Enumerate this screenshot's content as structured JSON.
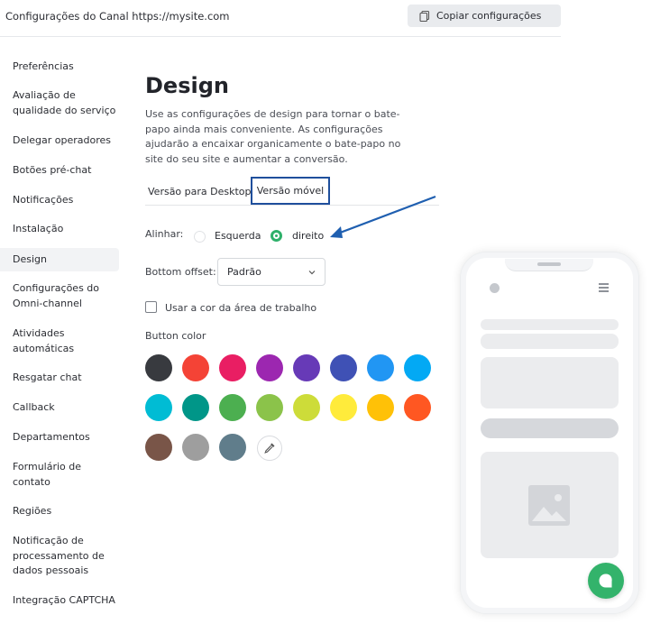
{
  "header": {
    "title": "Configurações do Canal https://mysite.com",
    "copy_button": {
      "label": "Copiar configurações",
      "icon": "copy-icon"
    }
  },
  "sidebar": {
    "items": [
      {
        "label": "Preferências"
      },
      {
        "label": "Avaliação de qualidade do serviço"
      },
      {
        "label": "Delegar operadores"
      },
      {
        "label": "Botões pré-chat"
      },
      {
        "label": "Notificações"
      },
      {
        "label": "Instalação"
      },
      {
        "label": "Design",
        "active": true
      },
      {
        "label": "Configurações do Omni-channel"
      },
      {
        "label": "Atividades automáticas"
      },
      {
        "label": "Resgatar chat"
      },
      {
        "label": "Callback"
      },
      {
        "label": "Departamentos"
      },
      {
        "label": "Formulário de contato"
      },
      {
        "label": "Regiões"
      },
      {
        "label": "Notificação de processamento de dados pessoais"
      },
      {
        "label": "Integração CAPTCHA"
      }
    ]
  },
  "main": {
    "title": "Design",
    "description": "Use as configurações de design para tornar o bate-papo ainda mais conveniente. As configurações ajudarão a encaixar organicamente o bate-papo no site do seu site e aumentar a conversão.",
    "tabs": [
      {
        "label": "Versão para Desktop",
        "selected": false
      },
      {
        "label": "Versão móvel",
        "selected": true
      }
    ],
    "align": {
      "label": "Alinhar:",
      "options": [
        {
          "label": "Esquerda",
          "selected": false
        },
        {
          "label": "direito",
          "selected": true
        }
      ]
    },
    "bottom_offset": {
      "label": "Bottom offset:",
      "value": "Padrão"
    },
    "workspace_color": {
      "label": "Usar a cor da área de trabalho",
      "checked": false
    },
    "button_color": {
      "label": "Button color",
      "colors": [
        "#383a3f",
        "#f44336",
        "#e91e63",
        "#9c27b0",
        "#673ab7",
        "#3f51b5",
        "#2196f3",
        "#03a9f4",
        "#00bcd4",
        "#009688",
        "#4caf50",
        "#8bc34a",
        "#cddc39",
        "#ffeb3b",
        "#ffc107",
        "#ff5722",
        "#795548",
        "#9e9e9e",
        "#607d8b"
      ],
      "picker_icon": "eyedropper-icon"
    }
  },
  "colors": {
    "accent": "#2eb06a",
    "tab_highlight": "#1f4f9c",
    "arrow": "#1f5fb0",
    "chat_button": "#33b36b"
  }
}
